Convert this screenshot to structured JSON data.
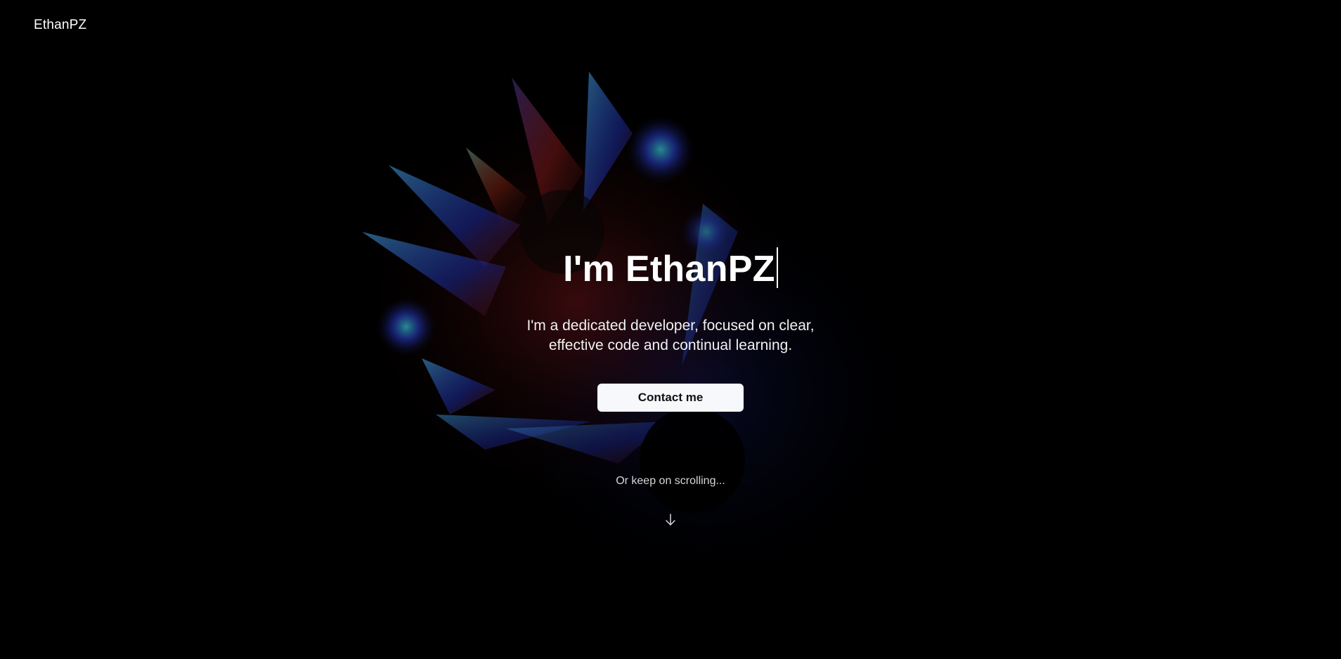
{
  "header": {
    "brand": "EthanPZ"
  },
  "hero": {
    "headline": "I'm EthanPZ",
    "tagline_line1": "I'm a dedicated developer, focused on clear,",
    "tagline_line2": "effective code and continual learning.",
    "contact_button_label": "Contact me",
    "scroll_hint": "Or keep on scrolling..."
  },
  "icons": {
    "scroll": "arrow-down-icon"
  },
  "colors": {
    "background": "#000000",
    "text": "#ffffff",
    "button_bg": "#f7f8fb",
    "button_text": "#111111",
    "art_blue": "#1a2fb0",
    "art_red": "#8a1a1a",
    "art_teal": "#2a7f8a"
  }
}
